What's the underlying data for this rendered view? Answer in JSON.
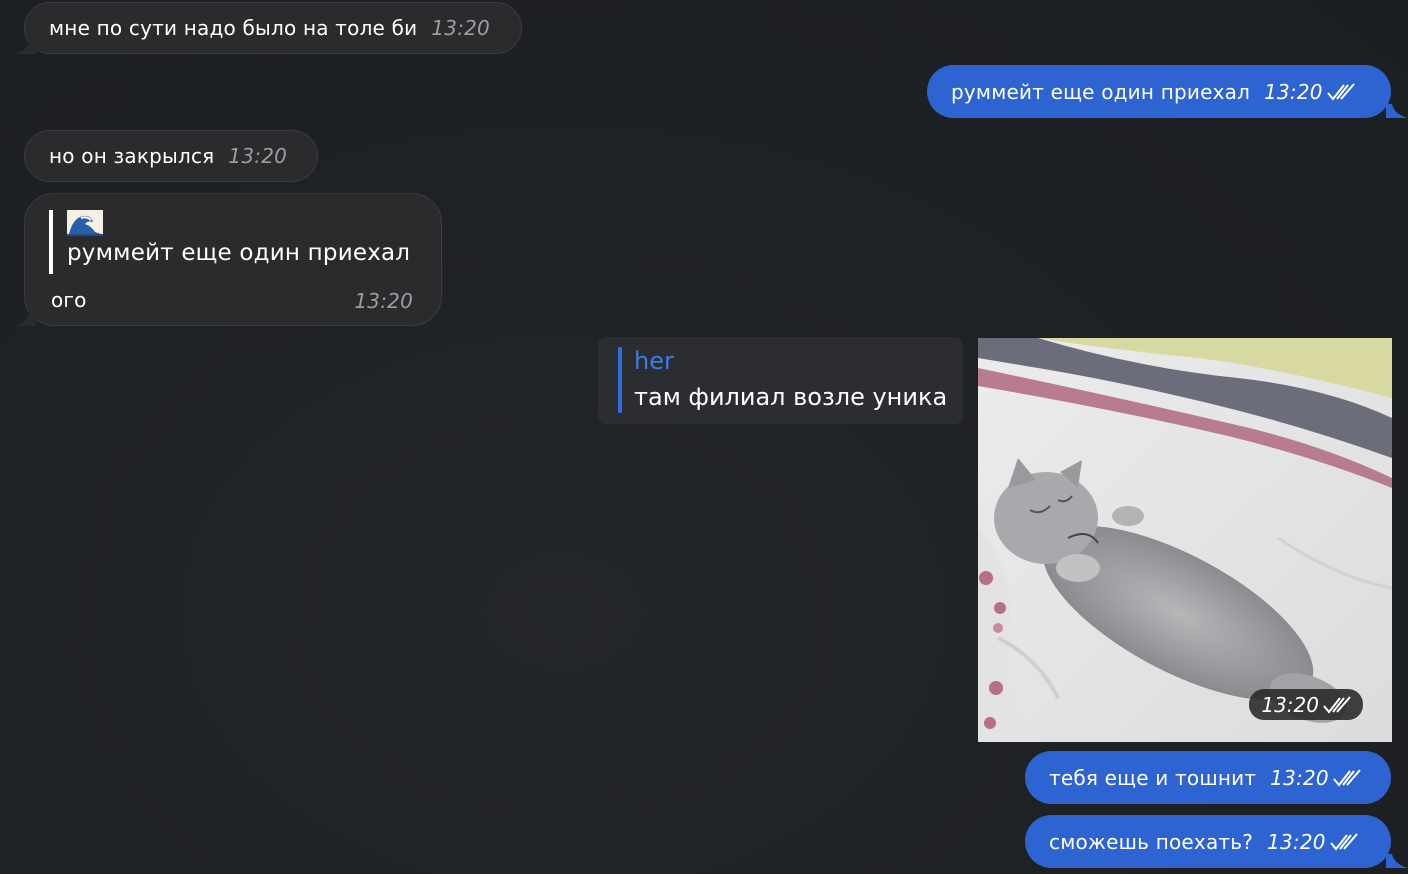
{
  "messages": [
    {
      "id": "m1",
      "direction": "incoming",
      "text": "мне по сути надо было на толе би",
      "time": "13:20"
    },
    {
      "id": "m2",
      "direction": "outgoing",
      "text": "руммейт еще один приехал",
      "time": "13:20",
      "status": "read"
    },
    {
      "id": "m3",
      "direction": "incoming",
      "text": "но он закрылся",
      "time": "13:20"
    },
    {
      "id": "m4",
      "direction": "incoming",
      "reply_author_icon": "wave-emoji-icon",
      "reply_text": "руммейт еще один приехал",
      "text": "ого",
      "time": "13:20"
    },
    {
      "id": "m5",
      "direction": "outgoing",
      "reply_author": "her",
      "reply_text": "там филиал возле уника",
      "media": "sleeping-kitten-gif",
      "time": "13:20",
      "status": "read"
    },
    {
      "id": "m6",
      "direction": "outgoing",
      "text": "тебя еще и тошнит",
      "time": "13:20",
      "status": "read"
    },
    {
      "id": "m7",
      "direction": "outgoing",
      "text": "сможешь поехать?",
      "time": "13:20",
      "status": "read"
    }
  ],
  "colors": {
    "background": "#1e2124",
    "incoming_bubble": "#2b2b2d",
    "outgoing_bubble": "#2e64d2",
    "reply_accent": "#2f6de0",
    "timestamp_incoming": "#9b9da1"
  }
}
